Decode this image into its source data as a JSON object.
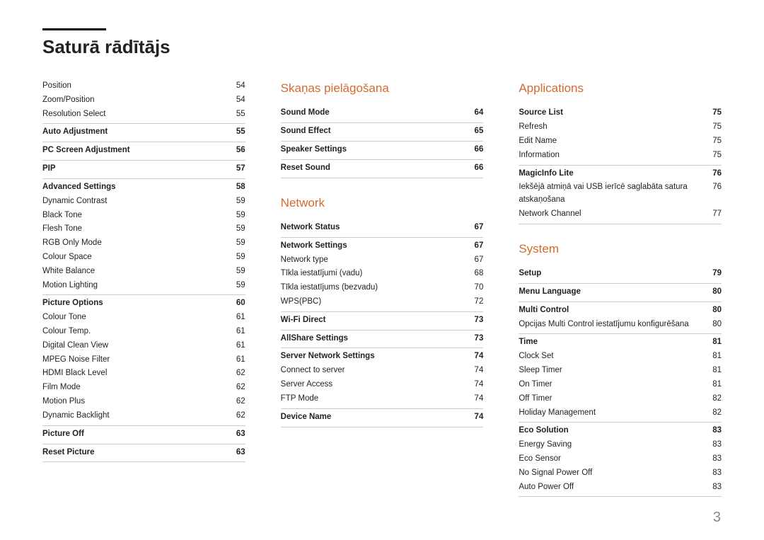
{
  "title": "Saturā rādītājs",
  "page_number": "3",
  "col1": {
    "pre_items": [
      {
        "label": "Position",
        "page": "54"
      },
      {
        "label": "Zoom/Position",
        "page": "54"
      },
      {
        "label": "Resolution Select",
        "page": "55"
      }
    ],
    "groups": [
      {
        "bold": {
          "label": "Auto Adjustment",
          "page": "55"
        },
        "items": []
      },
      {
        "bold": {
          "label": "PC Screen Adjustment",
          "page": "56"
        },
        "items": []
      },
      {
        "bold": {
          "label": "PIP",
          "page": "57"
        },
        "items": []
      },
      {
        "bold": {
          "label": "Advanced Settings",
          "page": "58"
        },
        "items": [
          {
            "label": "Dynamic Contrast",
            "page": "59"
          },
          {
            "label": "Black Tone",
            "page": "59"
          },
          {
            "label": "Flesh Tone",
            "page": "59"
          },
          {
            "label": "RGB Only Mode",
            "page": "59"
          },
          {
            "label": "Colour Space",
            "page": "59"
          },
          {
            "label": "White Balance",
            "page": "59"
          },
          {
            "label": "Motion Lighting",
            "page": "59"
          }
        ]
      },
      {
        "bold": {
          "label": "Picture Options",
          "page": "60"
        },
        "items": [
          {
            "label": "Colour Tone",
            "page": "61"
          },
          {
            "label": "Colour Temp.",
            "page": "61"
          },
          {
            "label": "Digital Clean View",
            "page": "61"
          },
          {
            "label": "MPEG Noise Filter",
            "page": "61"
          },
          {
            "label": "HDMI Black Level",
            "page": "62"
          },
          {
            "label": "Film Mode",
            "page": "62"
          },
          {
            "label": "Motion Plus",
            "page": "62"
          },
          {
            "label": "Dynamic Backlight",
            "page": "62"
          }
        ]
      },
      {
        "bold": {
          "label": "Picture Off",
          "page": "63"
        },
        "items": []
      },
      {
        "bold": {
          "label": "Reset Picture",
          "page": "63"
        },
        "items": [],
        "last": true
      }
    ]
  },
  "col2": {
    "sections": [
      {
        "title": "Skaņas pielāgošana",
        "groups": [
          {
            "bold": {
              "label": "Sound Mode",
              "page": "64"
            },
            "items": []
          },
          {
            "bold": {
              "label": "Sound Effect",
              "page": "65"
            },
            "items": []
          },
          {
            "bold": {
              "label": "Speaker Settings",
              "page": "66"
            },
            "items": []
          },
          {
            "bold": {
              "label": "Reset Sound",
              "page": "66"
            },
            "items": [],
            "last": true
          }
        ]
      },
      {
        "title": "Network",
        "groups": [
          {
            "bold": {
              "label": "Network Status",
              "page": "67"
            },
            "items": []
          },
          {
            "bold": {
              "label": "Network Settings",
              "page": "67"
            },
            "items": [
              {
                "label": "Network type",
                "page": "67"
              },
              {
                "label": "Tīkla iestatījumi (vadu)",
                "page": "68"
              },
              {
                "label": "Tīkla iestatījums (bezvadu)",
                "page": "70"
              },
              {
                "label": "WPS(PBC)",
                "page": "72"
              }
            ]
          },
          {
            "bold": {
              "label": "Wi-Fi Direct",
              "page": "73"
            },
            "items": []
          },
          {
            "bold": {
              "label": "AllShare Settings",
              "page": "73"
            },
            "items": []
          },
          {
            "bold": {
              "label": "Server Network Settings",
              "page": "74"
            },
            "items": [
              {
                "label": "Connect to server",
                "page": "74"
              },
              {
                "label": "Server Access",
                "page": "74"
              },
              {
                "label": "FTP Mode",
                "page": "74"
              }
            ]
          },
          {
            "bold": {
              "label": "Device Name",
              "page": "74"
            },
            "items": [],
            "last": true
          }
        ]
      }
    ]
  },
  "col3": {
    "sections": [
      {
        "title": "Applications",
        "groups": [
          {
            "bold": {
              "label": "Source List",
              "page": "75"
            },
            "items": [
              {
                "label": "Refresh",
                "page": "75"
              },
              {
                "label": "Edit Name",
                "page": "75"
              },
              {
                "label": "Information",
                "page": "75"
              }
            ]
          },
          {
            "bold": {
              "label": "MagicInfo Lite",
              "page": "76"
            },
            "items": [
              {
                "label": "Iekšējā atmiņā vai USB ierīcē saglabāta satura atskaņošana",
                "page": "76"
              },
              {
                "label": "Network Channel",
                "page": "77"
              }
            ],
            "last": true
          }
        ]
      },
      {
        "title": "System",
        "groups": [
          {
            "bold": {
              "label": "Setup",
              "page": "79"
            },
            "items": []
          },
          {
            "bold": {
              "label": "Menu Language",
              "page": "80"
            },
            "items": []
          },
          {
            "bold": {
              "label": "Multi Control",
              "page": "80"
            },
            "items": [
              {
                "label": "Opcijas Multi Control iestatījumu konfigurēšana",
                "page": "80"
              }
            ]
          },
          {
            "bold": {
              "label": "Time",
              "page": "81"
            },
            "items": [
              {
                "label": "Clock Set",
                "page": "81"
              },
              {
                "label": "Sleep Timer",
                "page": "81"
              },
              {
                "label": "On Timer",
                "page": "81"
              },
              {
                "label": "Off Timer",
                "page": "82"
              },
              {
                "label": "Holiday Management",
                "page": "82"
              }
            ]
          },
          {
            "bold": {
              "label": "Eco Solution",
              "page": "83"
            },
            "items": [
              {
                "label": "Energy Saving",
                "page": "83"
              },
              {
                "label": "Eco Sensor",
                "page": "83"
              },
              {
                "label": "No Signal Power Off",
                "page": "83"
              },
              {
                "label": "Auto Power Off",
                "page": "83"
              }
            ],
            "last": true
          }
        ]
      }
    ]
  }
}
